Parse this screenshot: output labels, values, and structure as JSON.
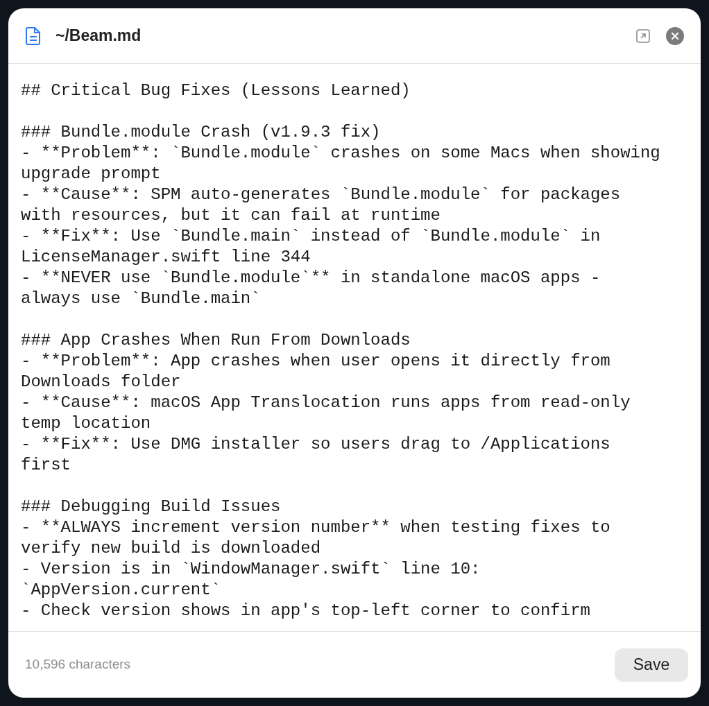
{
  "window": {
    "title": "~/Beam.md"
  },
  "editor": {
    "blocks": [
      {
        "lines": [
          "## Critical Bug Fixes (Lessons Learned)"
        ]
      },
      {
        "lines": [
          "### Bundle.module Crash (v1.9.3 fix)",
          "- **Problem**: `Bundle.module` crashes on some Macs when showing",
          "upgrade prompt",
          "- **Cause**: SPM auto-generates `Bundle.module` for packages",
          "with resources, but it can fail at runtime",
          "- **Fix**: Use `Bundle.main` instead of `Bundle.module` in",
          "LicenseManager.swift line 344",
          "- **NEVER use `Bundle.module`** in standalone macOS apps -",
          "always use `Bundle.main`"
        ]
      },
      {
        "lines": [
          "### App Crashes When Run From Downloads",
          "- **Problem**: App crashes when user opens it directly from",
          "Downloads folder",
          "- **Cause**: macOS App Translocation runs apps from read-only",
          "temp location",
          "- **Fix**: Use DMG installer so users drag to /Applications",
          "first"
        ]
      },
      {
        "lines": [
          "### Debugging Build Issues",
          "- **ALWAYS increment version number** when testing fixes to",
          "verify new build is downloaded",
          "- Version is in `WindowManager.swift` line 10:",
          "`AppVersion.current`",
          "- Check version shows in app's top-left corner to confirm"
        ]
      }
    ]
  },
  "footer": {
    "count": "10,596 characters",
    "save_button": "Save"
  }
}
